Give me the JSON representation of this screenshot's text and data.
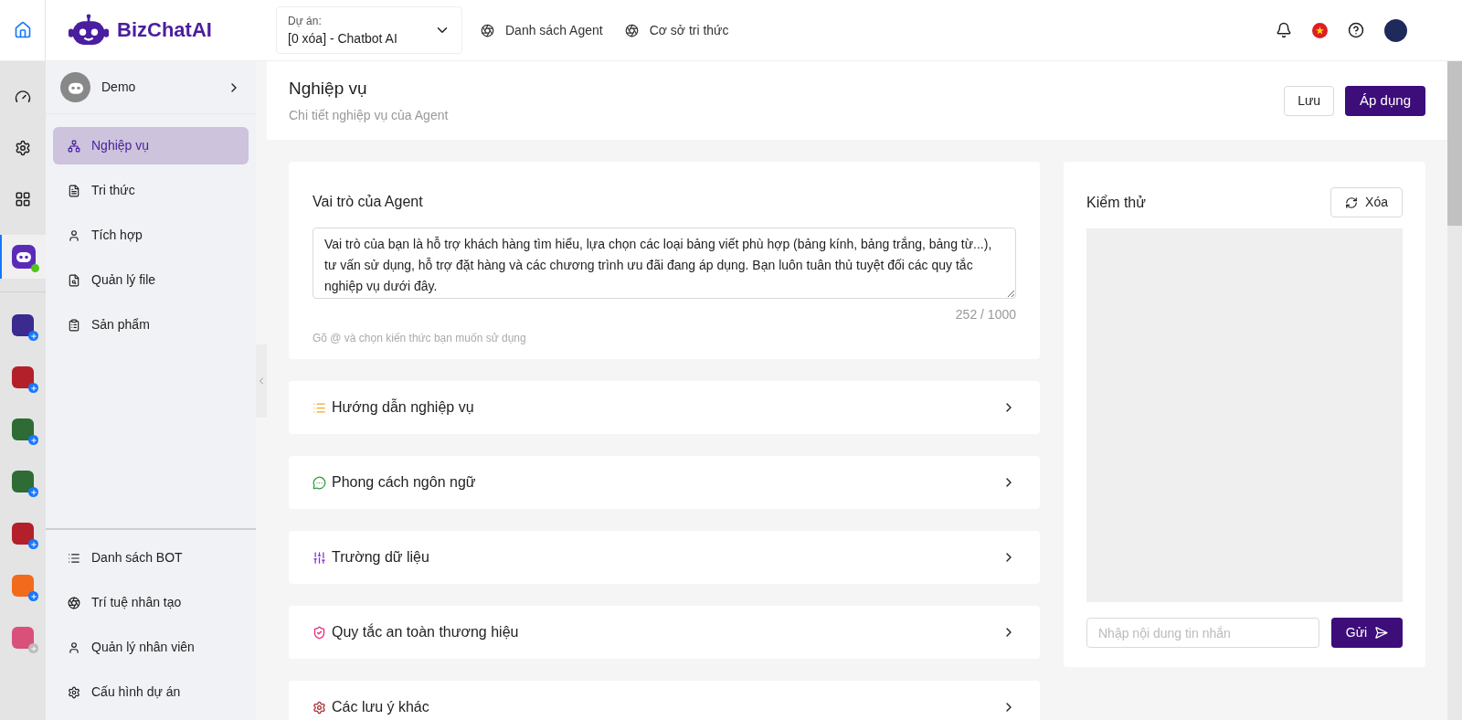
{
  "header": {
    "logo": "BizChatAI",
    "project": {
      "label": "Dự án:",
      "value": "[0 xóa] - Chatbot AI"
    },
    "links": [
      "Danh sách Agent",
      "Cơ sở tri thức"
    ]
  },
  "rail": {
    "apps": [
      {
        "color": "#3b2a8f",
        "badge_active": true
      },
      {
        "color": "#b3202a",
        "badge_active": true
      },
      {
        "color": "#2e6b35",
        "badge_active": true
      },
      {
        "color": "#2e6b35",
        "badge_active": true
      },
      {
        "color": "#b3202a",
        "badge_active": true
      },
      {
        "color": "#f26a1b",
        "badge_active": true
      },
      {
        "color": "#d9507a",
        "badge_active": false
      }
    ]
  },
  "sidebar": {
    "bot_name": "Demo",
    "items": [
      {
        "label": "Nghiệp vụ",
        "selected": true
      },
      {
        "label": "Tri thức",
        "selected": false
      },
      {
        "label": "Tích hợp",
        "selected": false
      },
      {
        "label": "Quản lý file",
        "selected": false
      },
      {
        "label": "Sản phẩm",
        "selected": false
      }
    ],
    "bottom_items": [
      "Danh sách BOT",
      "Trí tuệ nhân tạo",
      "Quản lý nhân viên",
      "Cấu hình dự án"
    ]
  },
  "page": {
    "title": "Nghiệp vụ",
    "subtitle": "Chi tiết nghiệp vụ của Agent",
    "buttons": [
      "Lưu",
      "Áp dụng"
    ]
  },
  "role_card": {
    "title": "Vai trò của Agent",
    "value": "Vai trò của bạn là hỗ trợ khách hàng tìm hiểu, lựa chọn các loại bảng viết phù hợp (bảng kính, bảng trắng, bảng từ...), tư vấn sử dụng, hỗ trợ đặt hàng và các chương trình ưu đãi đang áp dụng. Bạn luôn tuân thủ tuyệt đối các quy tắc nghiệp vụ dưới đây.",
    "counter": "252 / 1000",
    "hint": "Gõ @ và chọn kiến thức bạn muốn sử dụng"
  },
  "sections": [
    {
      "label": "Hướng dẫn nghiệp vụ",
      "kind": "list"
    },
    {
      "label": "Phong cách ngôn ngữ",
      "kind": "chat"
    },
    {
      "label": "Trường dữ liệu",
      "kind": "fields"
    },
    {
      "label": "Quy tắc an toàn thương hiệu",
      "kind": "shield"
    },
    {
      "label": "Các lưu ý khác",
      "kind": "gear"
    }
  ],
  "test_panel": {
    "title": "Kiểm thử",
    "clear_button": "Xóa",
    "input_placeholder": "Nhập nội dung tin nhắn",
    "send_button": "Gửi"
  }
}
